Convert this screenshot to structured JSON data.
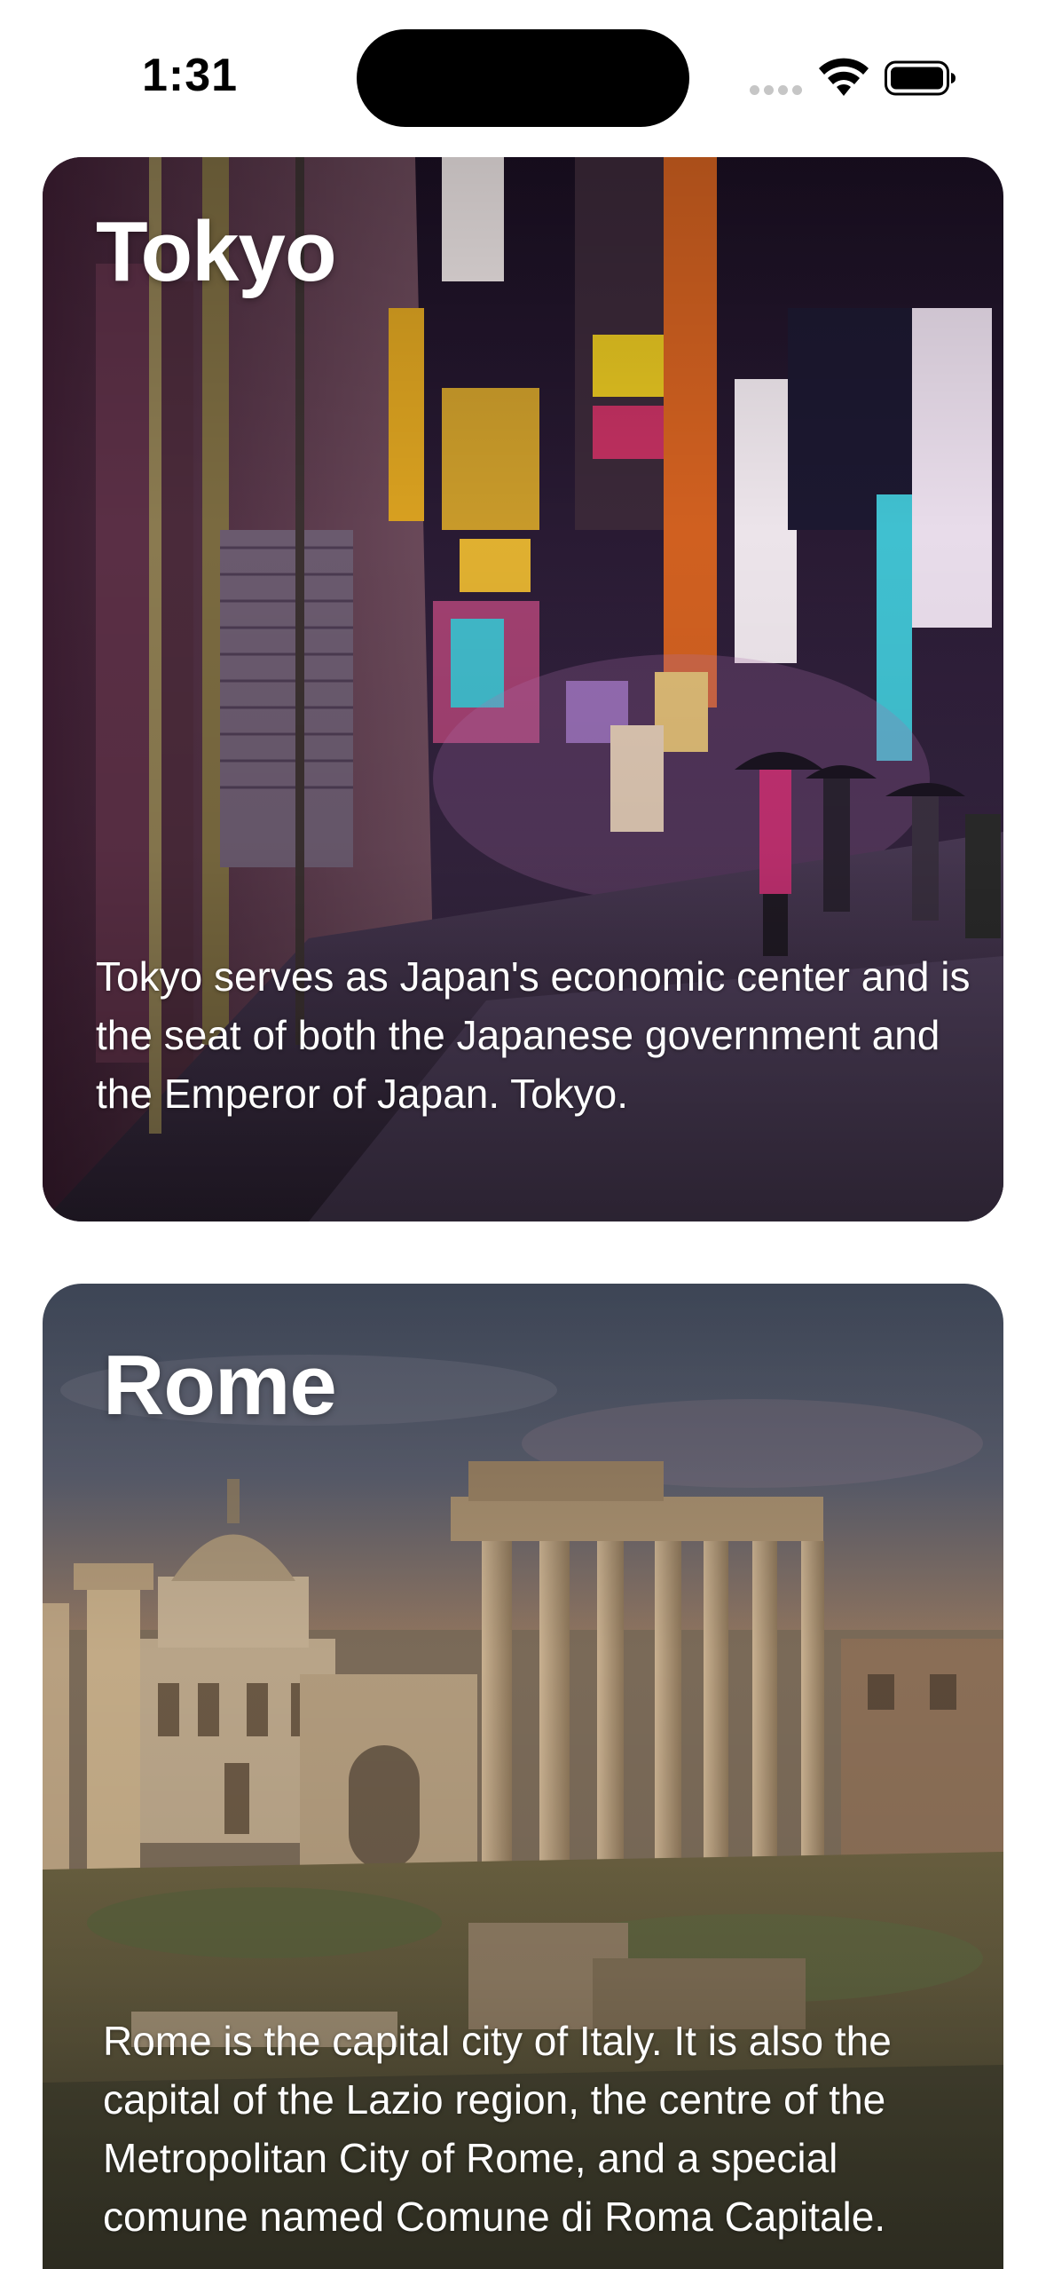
{
  "status_bar": {
    "time": "1:31"
  },
  "cards": [
    {
      "title": "Tokyo",
      "description": "Tokyo serves as Japan's economic center and is the seat of both the Japanese government and the Emperor of Japan. Tokyo.",
      "image": "tokyo-street-night-photo"
    },
    {
      "title": "Rome",
      "description": "Rome is the capital city of Italy. It is also the capital of the Lazio region, the centre of the Metropolitan City of Rome, and a special comune named Comune di Roma Capitale.",
      "image": "roman-forum-ruins-photo"
    }
  ],
  "colors": {
    "background": "#ffffff",
    "text_on_card": "#ffffff",
    "status_text": "#000000"
  }
}
